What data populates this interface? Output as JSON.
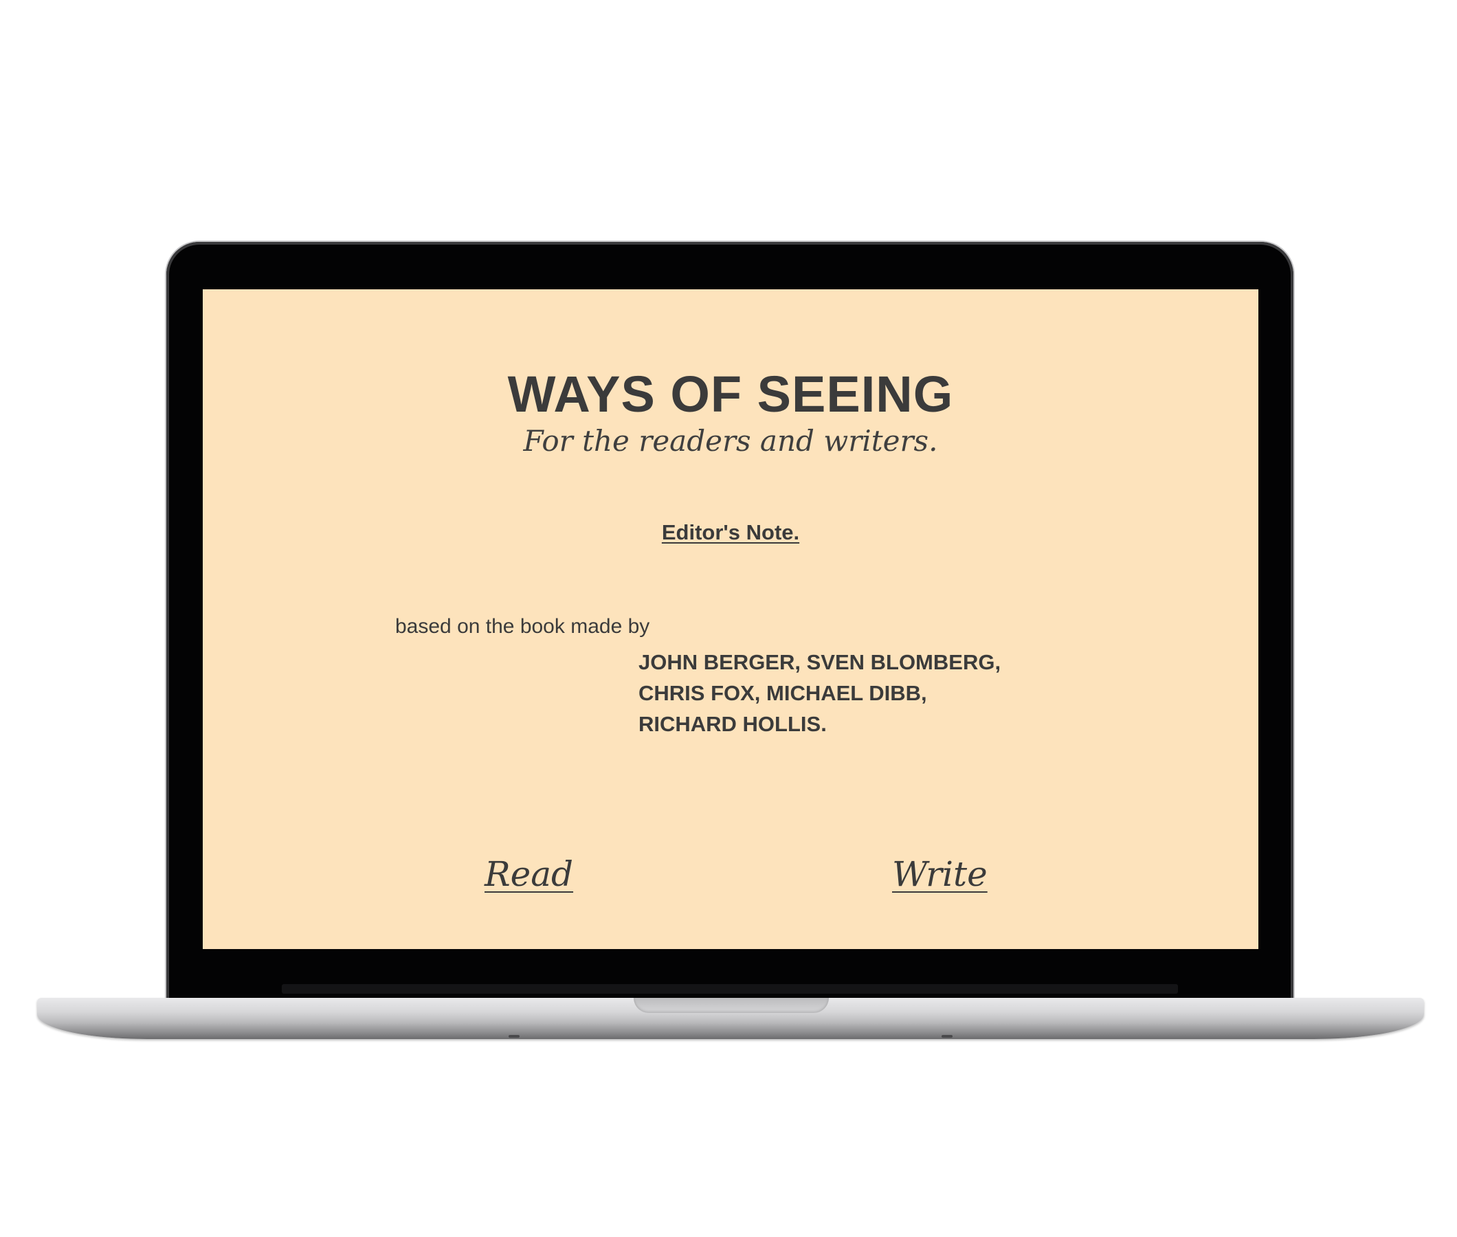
{
  "page": {
    "title": "WAYS OF SEEING",
    "tagline": "For the readers and writers.",
    "editors_note": "Editor's Note.",
    "based_on": "based on the book made by",
    "authors": [
      "JOHN BERGER, SVEN BLOMBERG,",
      "CHRIS FOX, MICHAEL DIBB,",
      "RICHARD HOLLIS."
    ],
    "nav": {
      "read": "Read",
      "write": "Write"
    }
  },
  "colors": {
    "screen_background": "#fde3bc",
    "text": "#3b3b3b",
    "bezel": "#030304"
  }
}
